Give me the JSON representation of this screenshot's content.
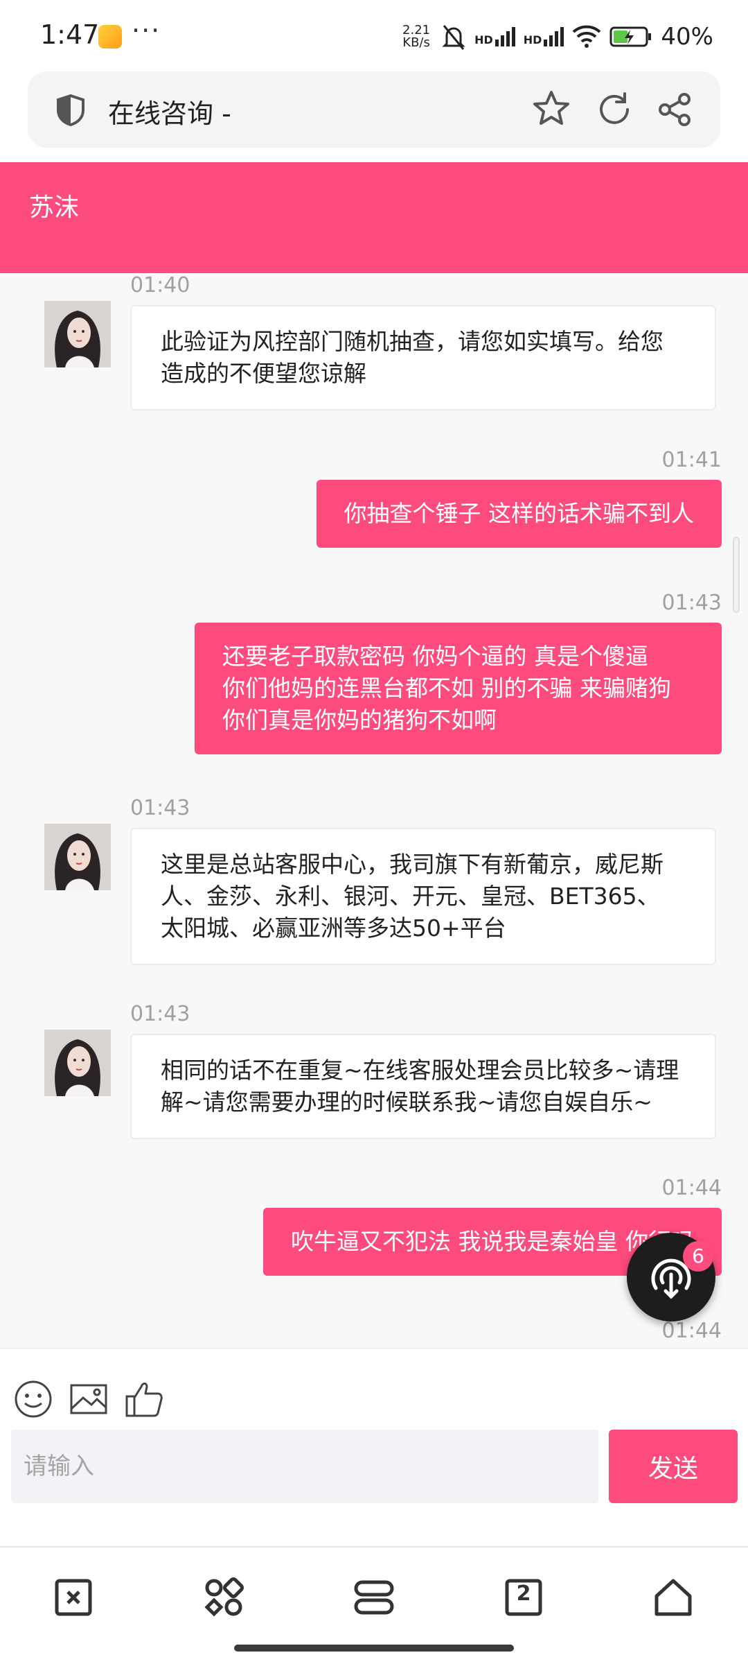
{
  "status_bar": {
    "time": "1:47",
    "more": "···",
    "net_speed_value": "2.21",
    "net_speed_unit": "KB/s",
    "sim1": "HD",
    "sim2": "HD",
    "battery": "40%"
  },
  "browser": {
    "page_title": "在线咨询 -"
  },
  "chat": {
    "agent_name": "苏沫",
    "messages": [
      {
        "time": "01:40",
        "text": "此验证为风控部门随机抽查，请您如实填写。给您\n造成的不便望您谅解"
      },
      {
        "time": "01:41",
        "text": "你抽查个锤子 这样的话术骗不到人"
      },
      {
        "time": "01:43",
        "text": "还要老子取款密码 你妈个逼的 真是个傻逼\n你们他妈的连黑台都不如 别的不骗 来骗赌狗\n你们真是你妈的猪狗不如啊"
      },
      {
        "time": "01:43",
        "text": "这里是总站客服中心，我司旗下有新葡京，威尼斯\n人、金莎、永利、银河、开元、皇冠、BET365、\n太阳城、必赢亚洲等多达50+平台"
      },
      {
        "time": "01:43",
        "text": "相同的话不在重复~在线客服处理会员比较多~请理\n解~请您需要办理的时候联系我~请您自娱自乐~"
      },
      {
        "time": "01:44",
        "text": "吹牛逼又不犯法 我说我是秦始皇 你行吗"
      },
      {
        "time": "01:44",
        "text": ""
      }
    ],
    "float_badge": "6"
  },
  "input": {
    "placeholder": "请输入",
    "send_label": "发送"
  },
  "bottom_nav": {
    "tabs_count": "2"
  }
}
